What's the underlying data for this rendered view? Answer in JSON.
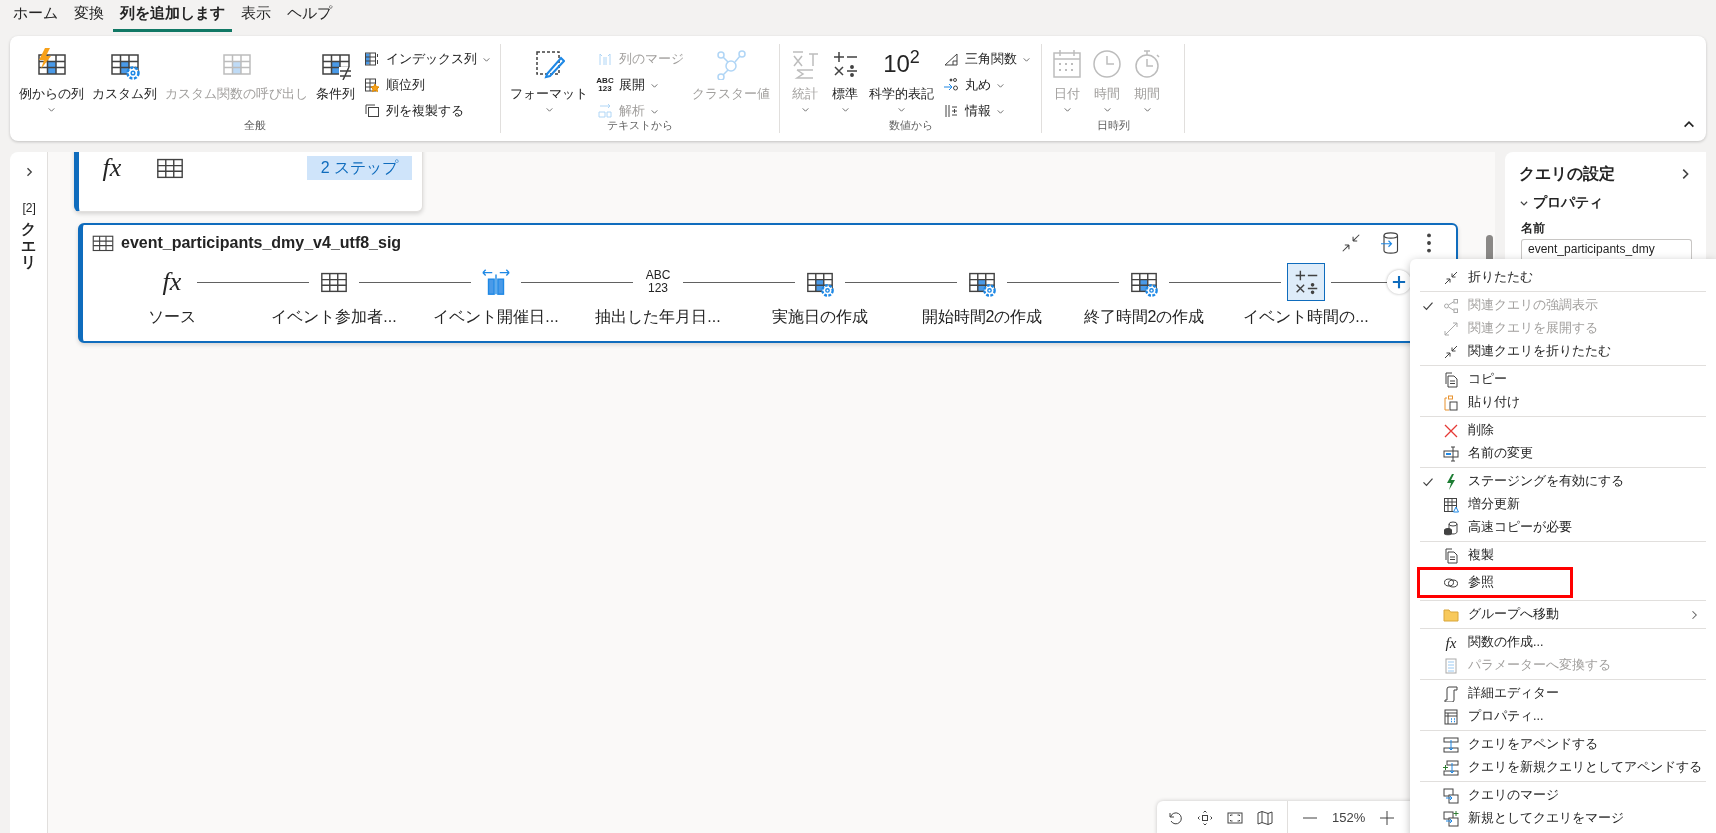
{
  "menu_bar": [
    {
      "label": "ホーム",
      "selected": false
    },
    {
      "label": "変換",
      "selected": false
    },
    {
      "label": "列を追加します",
      "selected": true
    },
    {
      "label": "表示",
      "selected": false
    },
    {
      "label": "ヘルプ",
      "selected": false
    }
  ],
  "ribbon": {
    "groups": [
      {
        "label": "全般",
        "items": [
          {
            "kind": "large",
            "label": "例からの列",
            "disabled": false,
            "dropdown": true
          },
          {
            "kind": "large",
            "label": "カスタム列",
            "disabled": false,
            "dropdown": false
          },
          {
            "kind": "large",
            "label": "カスタム関数の呼び出し",
            "disabled": true,
            "dropdown": false
          },
          {
            "kind": "large",
            "label": "条件列",
            "disabled": false,
            "dropdown": false
          },
          {
            "kind": "small",
            "label": "インデックス列",
            "disabled": false,
            "dropdown": true
          },
          {
            "kind": "small",
            "label": "順位列",
            "disabled": false,
            "dropdown": false
          },
          {
            "kind": "small",
            "label": "列を複製する",
            "disabled": false,
            "dropdown": false
          }
        ]
      },
      {
        "label": "テキストから",
        "items": [
          {
            "kind": "large",
            "label": "フォーマット",
            "disabled": false,
            "dropdown": true
          },
          {
            "kind": "small",
            "label": "列のマージ",
            "disabled": true,
            "dropdown": false
          },
          {
            "kind": "small",
            "label": "展開",
            "disabled": false,
            "dropdown": true,
            "icon_lines": [
              "ABC",
              "123"
            ]
          },
          {
            "kind": "small",
            "label": "解析",
            "disabled": true,
            "dropdown": true
          },
          {
            "kind": "large",
            "label": "クラスター値",
            "disabled": true,
            "dropdown": false
          }
        ]
      },
      {
        "label": "数値から",
        "items": [
          {
            "kind": "large",
            "label": "統計",
            "disabled": true,
            "dropdown": true
          },
          {
            "kind": "large",
            "label": "標準",
            "disabled": false,
            "dropdown": true
          },
          {
            "kind": "large",
            "label": "科学的表記",
            "disabled": false,
            "dropdown": true,
            "icon_text": "10$^{2}$"
          },
          {
            "kind": "small",
            "label": "三角関数",
            "disabled": false,
            "dropdown": true
          },
          {
            "kind": "small",
            "label": "丸め",
            "disabled": false,
            "dropdown": true
          },
          {
            "kind": "small",
            "label": "情報",
            "disabled": false,
            "dropdown": true
          }
        ]
      },
      {
        "label": "日時列",
        "items": [
          {
            "kind": "large",
            "label": "日付",
            "disabled": true,
            "dropdown": true
          },
          {
            "kind": "large",
            "label": "時間",
            "disabled": true,
            "dropdown": true
          },
          {
            "kind": "large",
            "label": "期間",
            "disabled": true,
            "dropdown": true
          }
        ]
      }
    ]
  },
  "sidebar": {
    "label": "クエリ",
    "count": "[2]"
  },
  "cards": [
    {
      "kind": "collapsed",
      "selected": false,
      "badge": "2 ステップ",
      "steps": [
        {
          "kind": "fx",
          "icon_text": "fx"
        },
        {
          "kind": "table"
        }
      ]
    },
    {
      "kind": "expanded",
      "selected": true,
      "title": "event_participants_dmy_v4_utf8_sig",
      "steps": [
        {
          "kind": "fx",
          "icon_text": "fx",
          "label": "ソース",
          "selected": false
        },
        {
          "kind": "table",
          "label": "イベント参加者...",
          "selected": false
        },
        {
          "kind": "split",
          "label": "イベント開催日...",
          "selected": false
        },
        {
          "kind": "abc",
          "icon_lines": [
            "ABC",
            "123"
          ],
          "label": "抽出した年月日...",
          "selected": false
        },
        {
          "kind": "custom",
          "label": "実施日の作成",
          "selected": false
        },
        {
          "kind": "custom",
          "label": "開始時間2の作成",
          "selected": false
        },
        {
          "kind": "custom",
          "label": "終了時間2の作成",
          "selected": false
        },
        {
          "kind": "math",
          "label": "イベント時間の...",
          "selected": true
        }
      ]
    }
  ],
  "query_settings": {
    "title": "クエリの設定",
    "section": "プロパティ",
    "name_label": "名前",
    "name_value": "event_participants_dmy"
  },
  "zoom_bar": {
    "level_text": "152%"
  },
  "context_menu": {
    "groups": [
      [
        {
          "label": "折りたたむ",
          "checked": false,
          "disabled": false,
          "highlighted": false,
          "submenu": false
        }
      ],
      [
        {
          "label": "関連クエリの強調表示",
          "checked": true,
          "disabled": true,
          "highlighted": false,
          "submenu": false
        },
        {
          "label": "関連クエリを展開する",
          "checked": false,
          "disabled": true,
          "highlighted": false,
          "submenu": false
        },
        {
          "label": "関連クエリを折りたたむ",
          "checked": false,
          "disabled": false,
          "highlighted": false,
          "submenu": false
        }
      ],
      [
        {
          "label": "コピー",
          "checked": false,
          "disabled": false,
          "highlighted": false,
          "submenu": false
        },
        {
          "label": "貼り付け",
          "checked": false,
          "disabled": false,
          "highlighted": false,
          "submenu": false
        }
      ],
      [
        {
          "label": "削除",
          "checked": false,
          "disabled": false,
          "highlighted": false,
          "submenu": false
        },
        {
          "label": "名前の変更",
          "checked": false,
          "disabled": false,
          "highlighted": false,
          "submenu": false
        }
      ],
      [
        {
          "label": "ステージングを有効にする",
          "checked": true,
          "disabled": false,
          "highlighted": false,
          "submenu": false
        },
        {
          "label": "増分更新",
          "checked": false,
          "disabled": false,
          "highlighted": false,
          "submenu": false
        },
        {
          "label": "高速コピーが必要",
          "checked": false,
          "disabled": false,
          "highlighted": false,
          "submenu": false
        }
      ],
      [
        {
          "label": "複製",
          "checked": false,
          "disabled": false,
          "highlighted": false,
          "submenu": false
        },
        {
          "label": "参照",
          "checked": false,
          "disabled": false,
          "highlighted": true,
          "submenu": false
        }
      ],
      [
        {
          "label": "グループへ移動",
          "checked": false,
          "disabled": false,
          "highlighted": false,
          "submenu": true
        }
      ],
      [
        {
          "label": "関数の作成...",
          "checked": false,
          "disabled": false,
          "highlighted": false,
          "submenu": false,
          "icon_text": "fx"
        },
        {
          "label": "パラメーターへ変換する",
          "checked": false,
          "disabled": true,
          "highlighted": false,
          "submenu": false
        }
      ],
      [
        {
          "label": "詳細エディター",
          "checked": false,
          "disabled": false,
          "highlighted": false,
          "submenu": false
        },
        {
          "label": "プロパティ...",
          "checked": false,
          "disabled": false,
          "highlighted": false,
          "submenu": false
        }
      ],
      [
        {
          "label": "クエリをアペンドする",
          "checked": false,
          "disabled": false,
          "highlighted": false,
          "submenu": false
        },
        {
          "label": "クエリを新規クエリとしてアペンドする",
          "checked": false,
          "disabled": false,
          "highlighted": false,
          "submenu": false
        }
      ],
      [
        {
          "label": "クエリのマージ",
          "checked": false,
          "disabled": false,
          "highlighted": false,
          "submenu": false
        },
        {
          "label": "新規としてクエリをマージ",
          "checked": false,
          "disabled": false,
          "highlighted": false,
          "submenu": false
        }
      ]
    ]
  }
}
